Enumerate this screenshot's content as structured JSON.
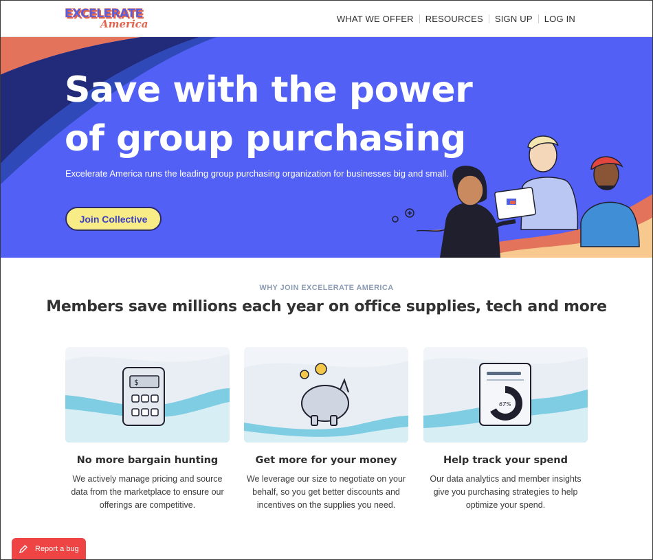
{
  "brand": {
    "logo_top": "EXCELERATE",
    "logo_bottom": "America"
  },
  "nav": {
    "items": [
      "WHAT WE OFFER",
      "RESOURCES",
      "SIGN UP",
      "LOG IN"
    ]
  },
  "hero": {
    "title": "Save with the power of group purchasing",
    "subtitle": "Excelerate America runs the leading group purchasing organization for businesses big and small.",
    "cta_label": "Join Collective"
  },
  "why": {
    "eyebrow": "WHY JOIN EXCELERATE AMERICA",
    "title": "Members save millions each year on office supplies, tech and more",
    "cards": [
      {
        "icon": "calculator-icon",
        "title": "No more bargain hunting",
        "text": "We actively manage pricing and source data from the marketplace to ensure our offerings are competitive."
      },
      {
        "icon": "piggy-bank-icon",
        "title": "Get more for your money",
        "text": "We leverage our size to negotiate on your behalf, so you get better discounts and incentives on the supplies you need."
      },
      {
        "icon": "report-chart-icon",
        "title": "Help track your spend",
        "text": "Our data analytics and member insights give you purchasing strategies to help optimize your spend.",
        "chart_label": "67%"
      }
    ]
  },
  "bug_button": {
    "label": "Report a bug"
  },
  "colors": {
    "hero_bg": "#5260f5",
    "cta_bg": "#f8ec86",
    "accent_orange": "#e0634e",
    "bug_red": "#ef4444"
  }
}
